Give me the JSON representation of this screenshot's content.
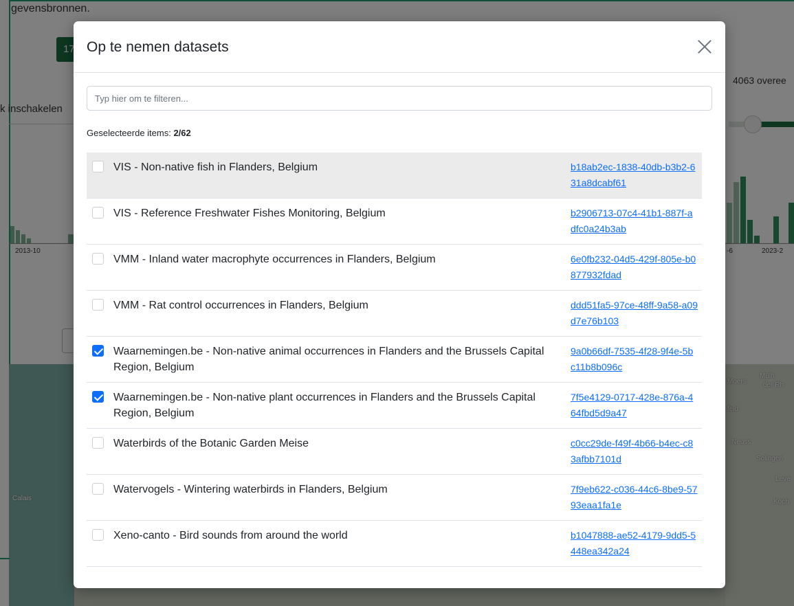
{
  "background": {
    "intro_text": "gevensbronnen.",
    "badge": "17",
    "left_label": "k inschakelen",
    "right_count": "4063 overee",
    "ticks": [
      "2013-10",
      "-6",
      "2023-2"
    ],
    "map_labels": [
      "Calais",
      "Moers",
      "Mülh",
      "der Rh",
      "feld",
      "Neuss",
      "Solingen",
      "Leve",
      "Koch"
    ]
  },
  "modal": {
    "title": "Op te nemen datasets",
    "close_icon": "close-icon",
    "filter_placeholder": "Typ hier om te filteren...",
    "selected_label": "Geselecteerde items: ",
    "selected_count": "2/62"
  },
  "datasets": [
    {
      "title": "VIS - Non-native fish in Flanders, Belgium",
      "uuid": "b18ab2ec-1838-40db-b3b2-631a8dcabf61",
      "checked": false,
      "hover": true
    },
    {
      "title": "VIS - Reference Freshwater Fishes Monitoring, Belgium",
      "uuid": "b2906713-07c4-41b1-887f-adfc0a24b3ab",
      "checked": false
    },
    {
      "title": "VMM - Inland water macrophyte occurrences in Flanders, Belgium",
      "uuid": "6e0fb232-04d5-429f-805e-b0877932fdad",
      "checked": false
    },
    {
      "title": "VMM - Rat control occurrences in Flanders, Belgium",
      "uuid": "ddd51fa5-97ce-48ff-9a58-a09d7e76b103",
      "checked": false
    },
    {
      "title": "Waarnemingen.be - Non-native animal occurrences in Flanders and the Brussels Capital Region, Belgium",
      "uuid": "9a0b66df-7535-4f28-9f4e-5bc11b8b096c",
      "checked": true
    },
    {
      "title": "Waarnemingen.be - Non-native plant occurrences in Flanders and the Brussels Capital Region, Belgium",
      "uuid": "7f5e4129-0717-428e-876a-464fbd5d9a47",
      "checked": true
    },
    {
      "title": "Waterbirds of the Botanic Garden Meise",
      "uuid": "c0cc29de-f49f-4b66-b4ec-c83afbb7101d",
      "checked": false
    },
    {
      "title": "Watervogels - Wintering waterbirds in Flanders, Belgium",
      "uuid": "7f9eb622-c036-44c6-8be9-5793eaa1fa1e",
      "checked": false
    },
    {
      "title": "Xeno-canto - Bird sounds from around the world",
      "uuid": "b1047888-ae52-4179-9dd5-5448ea342a24",
      "checked": false
    }
  ],
  "colors": {
    "accent": "#0d6efd",
    "brand": "#1b6e43",
    "frame": "#1f9f6e"
  }
}
